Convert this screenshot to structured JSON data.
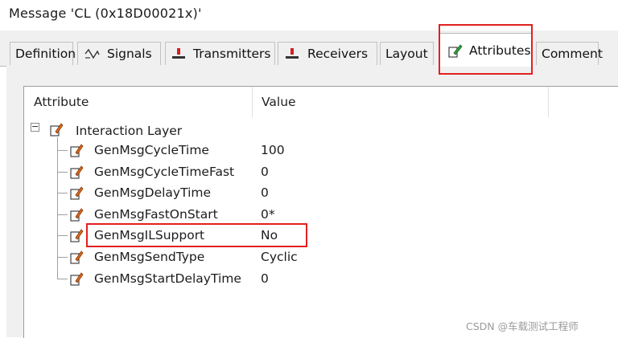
{
  "window": {
    "title": "Message 'CL (0x18D00021x)'"
  },
  "tabs": [
    {
      "label": "Definition",
      "icon": "none"
    },
    {
      "label": "Signals",
      "icon": "signals-icon"
    },
    {
      "label": "Transmitters",
      "icon": "transmitter-icon"
    },
    {
      "label": "Receivers",
      "icon": "receiver-icon"
    },
    {
      "label": "Layout",
      "icon": "none"
    },
    {
      "label": "Attributes",
      "icon": "attribute-pencil-icon",
      "active": true
    },
    {
      "label": "Comment",
      "icon": "none"
    }
  ],
  "columns": {
    "attribute": "Attribute",
    "value": "Value"
  },
  "tree": {
    "group": {
      "label": "Interaction Layer",
      "expander": "−"
    },
    "rows": [
      {
        "name": "GenMsgCycleTime",
        "value": "100"
      },
      {
        "name": "GenMsgCycleTimeFast",
        "value": "0"
      },
      {
        "name": "GenMsgDelayTime",
        "value": "0"
      },
      {
        "name": "GenMsgFastOnStart",
        "value": "0*"
      },
      {
        "name": "GenMsgILSupport",
        "value": "No",
        "highlighted": true
      },
      {
        "name": "GenMsgSendType",
        "value": "Cyclic"
      },
      {
        "name": "GenMsgStartDelayTime",
        "value": "0"
      }
    ]
  },
  "colors": {
    "highlight": "#e2201f",
    "tab_bg": "#f0f0f0",
    "icon_red": "#d42020",
    "icon_green": "#2e9d3a"
  },
  "watermark": "CSDN @车载测试工程师"
}
